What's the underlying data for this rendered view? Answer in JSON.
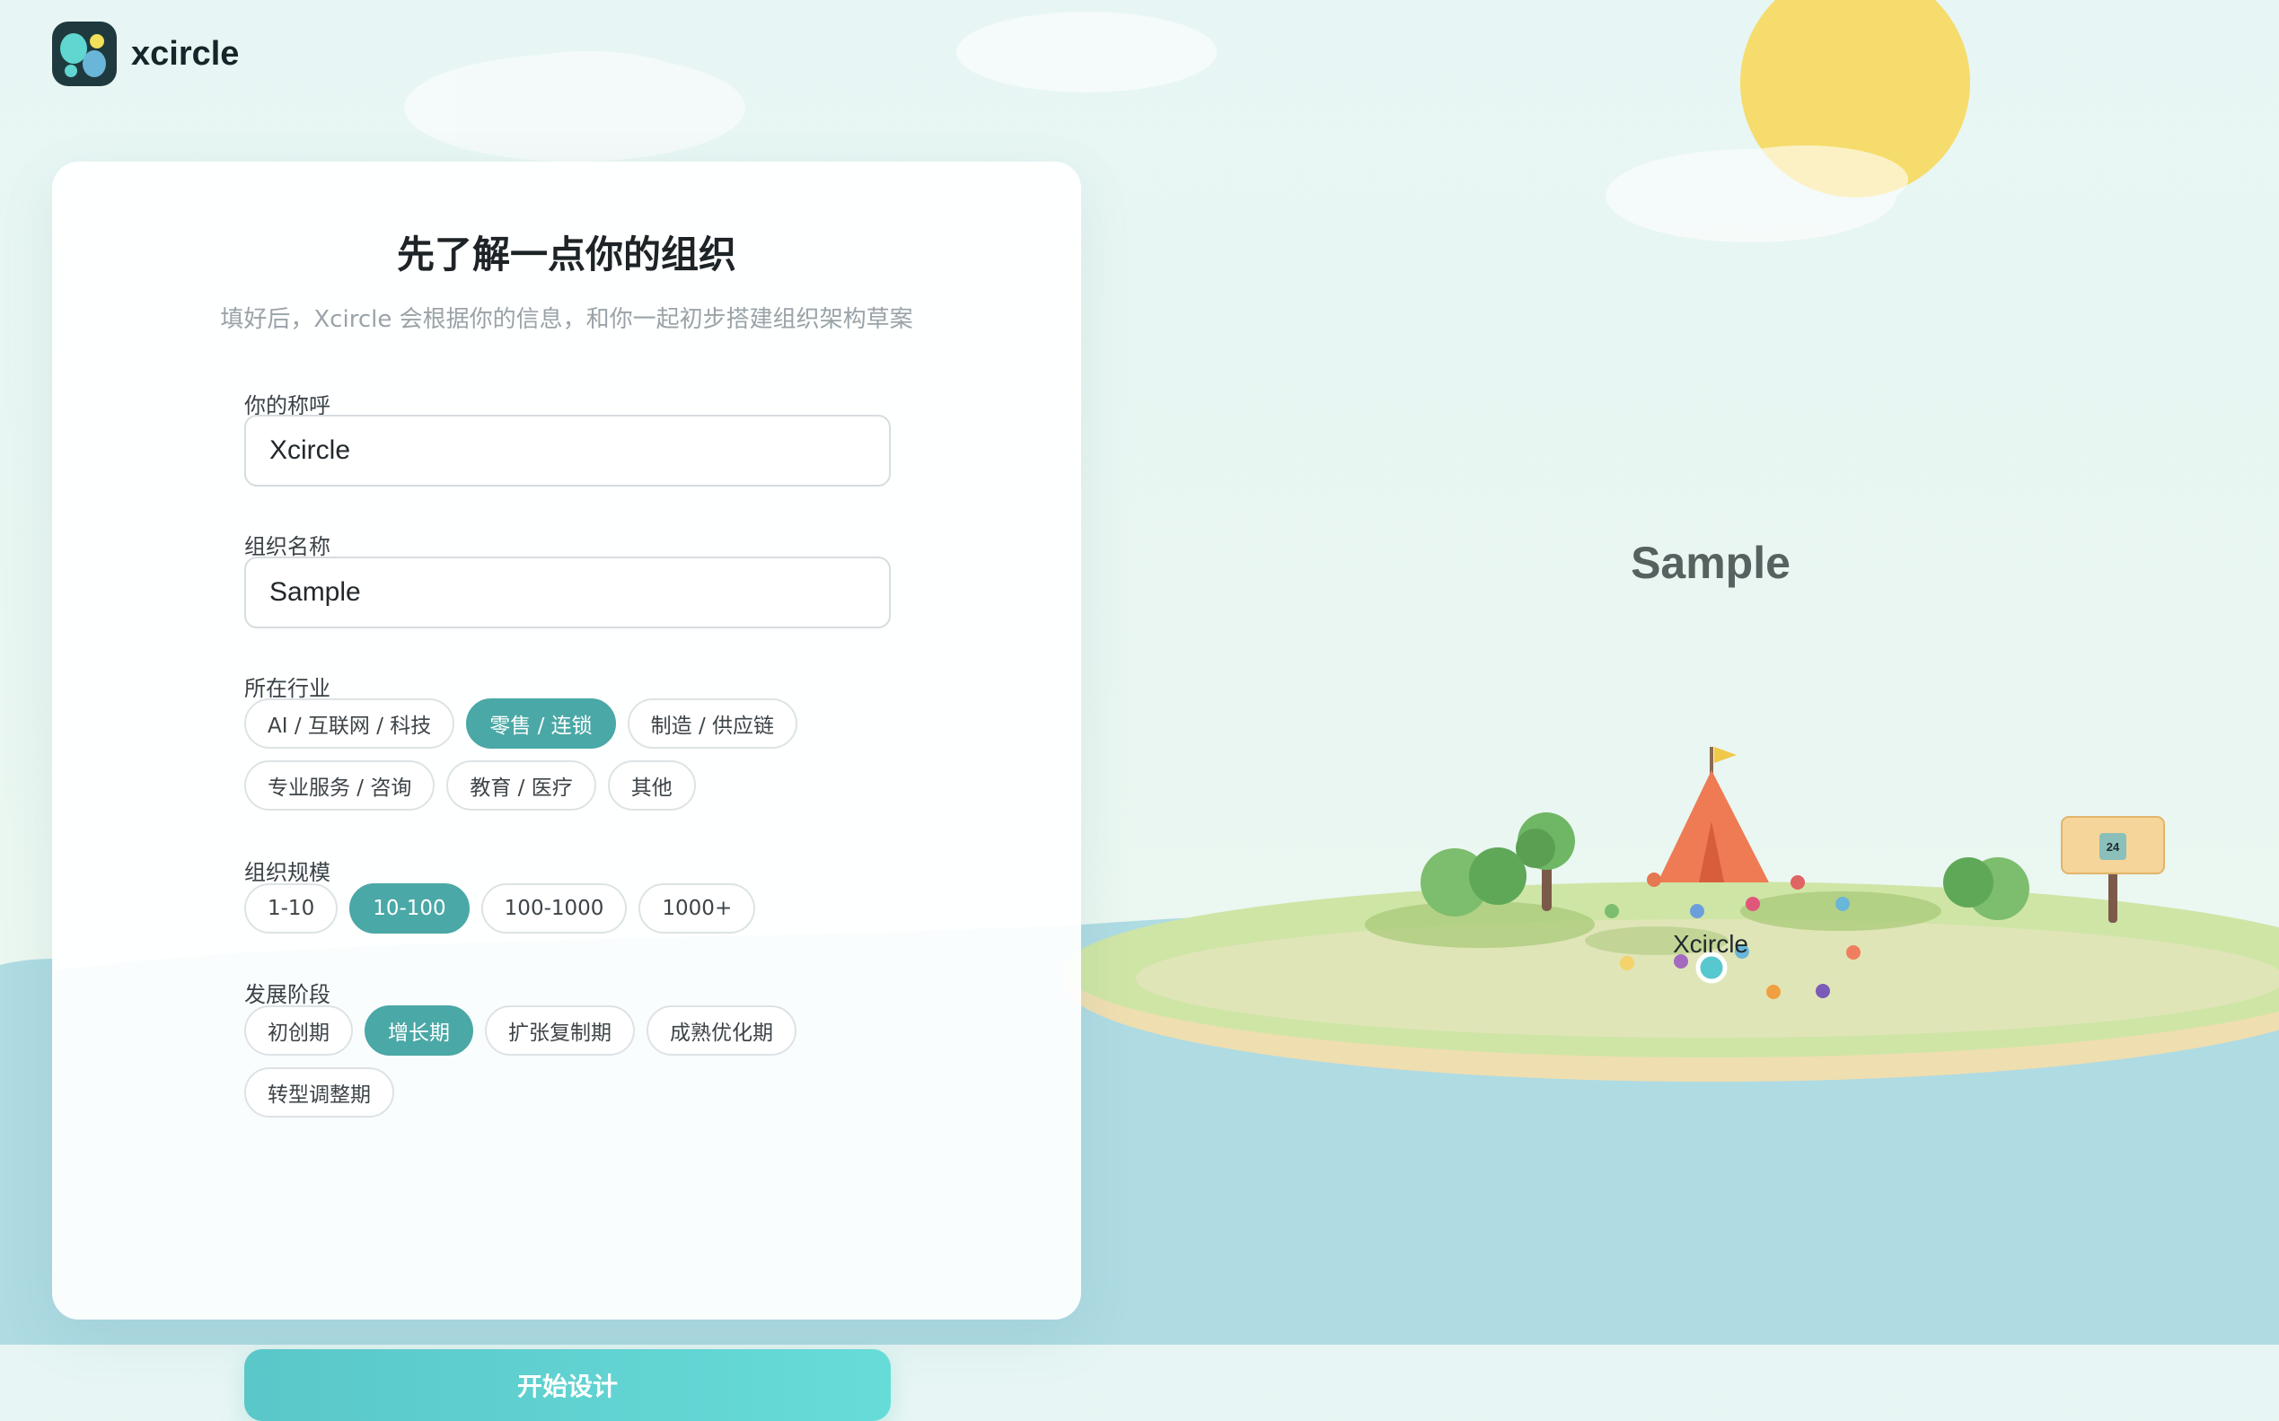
{
  "brand": {
    "name": "xcircle"
  },
  "form": {
    "title": "先了解一点你的组织",
    "subtitle": "填好后，Xcircle 会根据你的信息，和你一起初步搭建组织架构草案",
    "name_label": "你的称呼",
    "name_value": "Xcircle",
    "org_label": "组织名称",
    "org_value": "Sample",
    "industry_label": "所在行业",
    "industry_options": [
      "AI / 互联网 / 科技",
      "零售 / 连锁",
      "制造 / 供应链",
      "专业服务 / 咨询",
      "教育 / 医疗",
      "其他"
    ],
    "industry_selected": "零售 / 连锁",
    "size_label": "组织规模",
    "size_options": [
      "1-10",
      "10-100",
      "100-1000",
      "1000+"
    ],
    "size_selected": "10-100",
    "stage_label": "发展阶段",
    "stage_options": [
      "初创期",
      "增长期",
      "扩张复制期",
      "成熟优化期",
      "转型调整期"
    ],
    "stage_selected": "增长期",
    "submit_label": "开始设计"
  },
  "preview": {
    "org_title": "Sample",
    "user_label": "Xcircle",
    "sign_text": "24"
  },
  "colors": {
    "accent": "#4aa8a6",
    "button": "#5ac7c9",
    "sun": "#f6dc6c",
    "tent": "#ee7b53",
    "sea": "#afdbe3",
    "island_grass": "#cfe5a6",
    "island_sand": "#efdeb0"
  }
}
